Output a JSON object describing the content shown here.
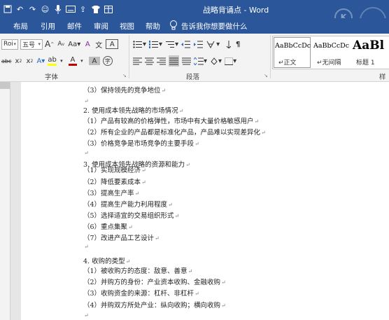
{
  "title_bar": {
    "title": "战略背诵点 - Word",
    "qat_icons": [
      "save-icon",
      "undo-icon",
      "redo-icon",
      "smiley-icon",
      "microphone-icon",
      "keyboard-icon",
      "share-icon",
      "shirt-icon",
      "table-icon"
    ],
    "watermark_glyph": "K"
  },
  "menu": {
    "tabs": [
      "布局",
      "引用",
      "邮件",
      "审阅",
      "视图",
      "帮助"
    ],
    "tell_me": "告诉我你想要做什么"
  },
  "ribbon": {
    "font": {
      "name": "Roi",
      "size": "五号",
      "grow": "A",
      "shrink": "A",
      "case": "Aa",
      "clear": "A",
      "pinyin": "文",
      "border_char": "A",
      "strike": "abc",
      "subscript": "x",
      "superscript": "x",
      "effects": "A",
      "highlight": "ab",
      "color": "A",
      "shade": "A",
      "enclose": "字",
      "label": "字体"
    },
    "paragraph": {
      "label": "段落"
    },
    "styles": {
      "items": [
        {
          "sample": "AaBbCcDc",
          "name": "正文"
        },
        {
          "sample": "AaBbCcDc",
          "name": "无间隔"
        },
        {
          "sample": "AaBl",
          "name": "标题 1"
        }
      ],
      "label": "样"
    },
    "accent_colors": {
      "title_bar": "#2b579a",
      "font_color": "#c00000",
      "highlight": "#ffff00"
    }
  },
  "document": {
    "lines": [
      {
        "text": "（3）保持领先的竞争地位",
        "mark": "↵"
      },
      {
        "text": "",
        "mark": "↵"
      },
      {
        "text": "2. 使用成本领先战略的市场情况",
        "mark": "↵"
      },
      {
        "text": "（1）产品有较高的价格弹性，市场中有大量价格敏感用户",
        "mark": "↵"
      },
      {
        "text": "（2）所有企业的产品都是标准化产品，产品难以实现差异化",
        "mark": "↵"
      },
      {
        "text": "（3）价格竞争是市场竞争的主要手段",
        "mark": "↵"
      },
      {
        "text": "",
        "mark": "↵"
      },
      {
        "text": "3. 使用成本领先战略的资源和能力",
        "mark": "↵"
      },
      {
        "text": "（1）实现规模经济",
        "mark": "↵"
      },
      {
        "text": "（2）降低要素成本",
        "mark": "↵"
      },
      {
        "text": "（3）提高生产率",
        "mark": "↵"
      },
      {
        "text": "（4）提高生产能力利用程度",
        "mark": "↵"
      },
      {
        "text": "（5）选择适宜的交易组织形式",
        "mark": "↵"
      },
      {
        "text": "（6）重点集聚",
        "mark": "↵"
      },
      {
        "text": "（7）改进产品工艺设计",
        "mark": "↵"
      },
      {
        "text": "",
        "mark": "↵"
      },
      {
        "text": "4. 收购的类型",
        "mark": "↵"
      },
      {
        "text": "（1）被收购方的态度：敌意、善意",
        "mark": "↵"
      },
      {
        "text": "（2）并购方的身份：产业资本收购、金融收购",
        "mark": "↵"
      },
      {
        "text": "（3）收购资金的来源：杠杆、非杠杆",
        "mark": "↵"
      },
      {
        "text": "（4）并购双方所处产业：纵向收购；横向收购",
        "mark": "↵"
      },
      {
        "text": "",
        "mark": "↵"
      }
    ]
  }
}
